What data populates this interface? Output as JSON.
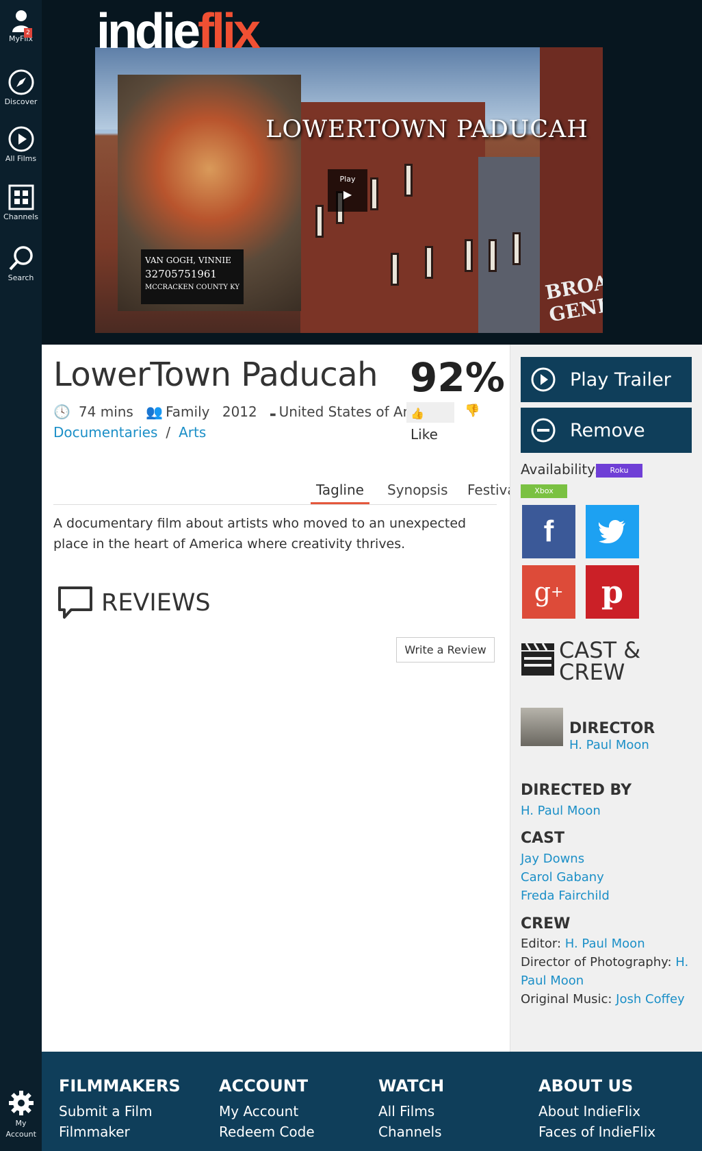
{
  "nav": {
    "myflix": {
      "label": "MyFlix",
      "badge": "2"
    },
    "discover": {
      "label": "Discover"
    },
    "all_films": {
      "label": "All Films"
    },
    "channels": {
      "label": "Channels"
    },
    "search": {
      "label": "Search"
    },
    "account": {
      "label": "My Account"
    }
  },
  "brand": {
    "part1": "indie",
    "part2": "flix",
    "accent": "#f05033"
  },
  "hero": {
    "poster_title": "LOWERTOWN PADUCAH",
    "play_label": "Play",
    "plaque_line1": "VAN GOGH, VINNIE",
    "plaque_line2": "32705751961",
    "plaque_line3": "MCCRACKEN COUNTY KY",
    "sign_text": "BROA GENERA"
  },
  "film": {
    "title": "LowerTown Paducah",
    "score": "92%",
    "duration": "74 mins",
    "rating": "Family",
    "year": "2012",
    "country": "United States of America",
    "like_label": "Like",
    "genres": [
      "Documentaries",
      "Arts"
    ]
  },
  "tabs": [
    "Tagline",
    "Synopsis",
    "Festivals"
  ],
  "active_tab": "Tagline",
  "tagline": "A documentary film about artists who moved to an unexpected place in the heart of America where creativity thrives.",
  "reviews": {
    "heading": "REVIEWS",
    "write_label": "Write a Review"
  },
  "actions": {
    "play_trailer": "Play Trailer",
    "remove": "Remove"
  },
  "availability": {
    "label": "Availability:",
    "platforms": [
      {
        "name": "Roku",
        "color": "#6f3fd6"
      },
      {
        "name": "Xbox",
        "color": "#7ac142"
      }
    ]
  },
  "social": [
    {
      "name": "facebook-icon",
      "glyph": "f",
      "color": "#3b5998"
    },
    {
      "name": "twitter-icon",
      "glyph": "",
      "color": "#1da1f2"
    },
    {
      "name": "google-plus-icon",
      "glyph": "g+",
      "color": "#dd4b39"
    },
    {
      "name": "pinterest-icon",
      "glyph": "p",
      "color": "#cb2027"
    }
  ],
  "cast_crew": {
    "heading": "CAST & CREW",
    "director_role": "DIRECTOR",
    "director_name": "H. Paul Moon",
    "directed_by_heading": "DIRECTED BY",
    "directed_by": "H. Paul Moon",
    "cast_heading": "CAST",
    "cast": [
      "Jay Downs",
      "Carol Gabany",
      "Freda Fairchild"
    ],
    "crew_heading": "CREW",
    "crew": [
      {
        "role": "Editor:",
        "name": "H. Paul Moon"
      },
      {
        "role": "Director of Photography:",
        "name": "H. Paul Moon"
      },
      {
        "role": "Original Music:",
        "name": "Josh Coffey"
      }
    ]
  },
  "footer": {
    "filmmakers": {
      "heading": "FILMMAKERS",
      "links": [
        "Submit a Film",
        "Filmmaker"
      ]
    },
    "account": {
      "heading": "ACCOUNT",
      "links": [
        "My Account",
        "Redeem Code"
      ]
    },
    "watch": {
      "heading": "WATCH",
      "links": [
        "All Films",
        "Channels"
      ]
    },
    "about": {
      "heading": "ABOUT US",
      "links": [
        "About IndieFlix",
        "Faces of IndieFlix"
      ]
    }
  },
  "colors": {
    "sidebar": "#0b1f2c",
    "primary": "#0f3e5a",
    "link": "#1b8fc7",
    "tab_active": "#e4573c"
  }
}
